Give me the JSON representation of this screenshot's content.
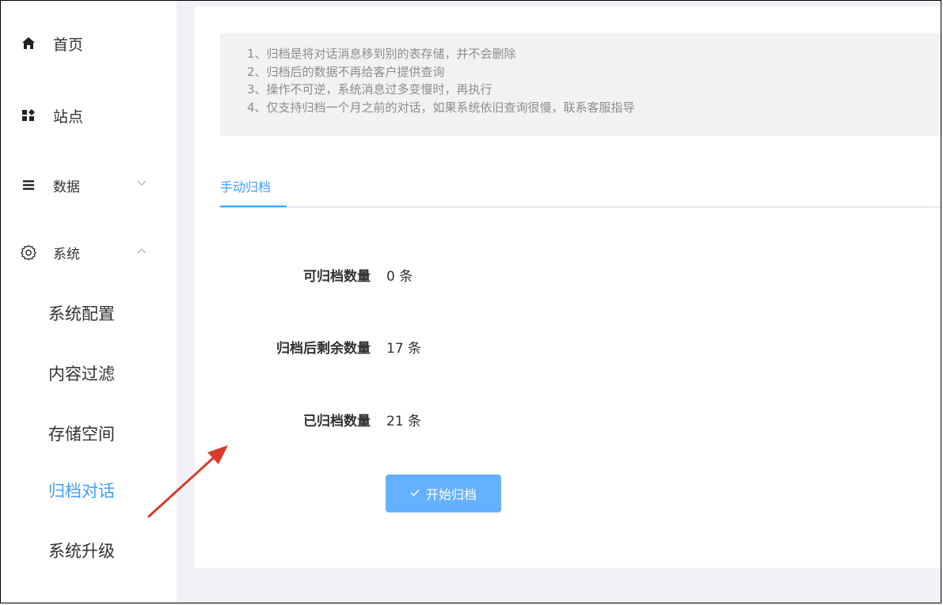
{
  "sidebar": {
    "items": [
      {
        "label": "首页",
        "icon": "home-icon"
      },
      {
        "label": "站点",
        "icon": "grid-icon"
      },
      {
        "label": "数据",
        "icon": "list-icon",
        "expanded": false
      },
      {
        "label": "系统",
        "icon": "gear-icon",
        "expanded": true
      }
    ],
    "sub_items": [
      {
        "label": "系统配置"
      },
      {
        "label": "内容过滤"
      },
      {
        "label": "存储空间"
      },
      {
        "label": "归档对话",
        "active": true
      },
      {
        "label": "系统升级"
      }
    ]
  },
  "notice": {
    "lines": [
      "1、归档是将对话消息移到别的表存储，并不会删除",
      "2、归档后的数据不再给客户提供查询",
      "3、操作不可逆，系统消息过多变慢时，再执行",
      "4、仅支持归档一个月之前的对话，如果系统依旧查询很慢，联系客服指导"
    ]
  },
  "tabs": [
    {
      "label": "手动归档",
      "active": true
    }
  ],
  "form": {
    "archivable": {
      "label": "可归档数量",
      "value": "0 条"
    },
    "remaining": {
      "label": "归档后剩余数量",
      "value": "17 条"
    },
    "archived": {
      "label": "已归档数量",
      "value": "21 条"
    }
  },
  "start_button": {
    "label": "开始归档",
    "icon": "check-icon"
  },
  "colors": {
    "accent": "#409eff",
    "button": "#66b1ff",
    "annotation_arrow": "#d93a2b"
  }
}
